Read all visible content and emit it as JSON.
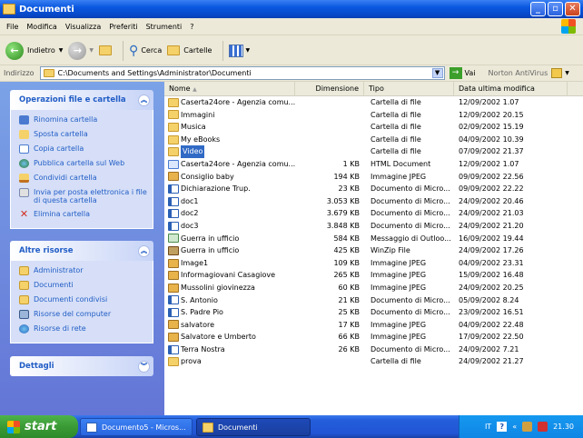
{
  "window": {
    "title": "Documenti"
  },
  "menu": [
    "File",
    "Modifica",
    "Visualizza",
    "Preferiti",
    "Strumenti",
    "?"
  ],
  "toolbar": {
    "back": "Indietro",
    "search": "Cerca",
    "folders": "Cartelle"
  },
  "address": {
    "label": "Indirizzo",
    "path": "C:\\Documents and Settings\\Administrator\\Documenti",
    "go": "Vai",
    "antivirus": "Norton AntiVirus"
  },
  "tasks": {
    "file_folder": {
      "title": "Operazioni file e cartella",
      "items": [
        "Rinomina cartella",
        "Sposta cartella",
        "Copia cartella",
        "Pubblica cartella sul Web",
        "Condividi cartella",
        "Invia per posta elettronica i file di questa cartella",
        "Elimina cartella"
      ]
    },
    "other": {
      "title": "Altre risorse",
      "items": [
        "Administrator",
        "Documenti",
        "Documenti condivisi",
        "Risorse del computer",
        "Risorse di rete"
      ]
    },
    "details": {
      "title": "Dettagli"
    }
  },
  "columns": {
    "name": "Nome",
    "size": "Dimensione",
    "type": "Tipo",
    "date": "Data ultima modifica"
  },
  "files": [
    {
      "name": "Caserta24ore - Agenzia comu...",
      "size": "",
      "type": "Cartella di file",
      "date": "12/09/2002 1.07",
      "icon": "folder"
    },
    {
      "name": "Immagini",
      "size": "",
      "type": "Cartella di file",
      "date": "12/09/2002 20.15",
      "icon": "folder"
    },
    {
      "name": "Musica",
      "size": "",
      "type": "Cartella di file",
      "date": "02/09/2002 15.19",
      "icon": "folder"
    },
    {
      "name": "My eBooks",
      "size": "",
      "type": "Cartella di file",
      "date": "04/09/2002 10.39",
      "icon": "folder"
    },
    {
      "name": "Video",
      "size": "",
      "type": "Cartella di file",
      "date": "07/09/2002 21.37",
      "icon": "folder",
      "selected": true
    },
    {
      "name": "Caserta24ore - Agenzia comu...",
      "size": "1 KB",
      "type": "HTML Document",
      "date": "12/09/2002 1.07",
      "icon": "html"
    },
    {
      "name": "Consiglio baby",
      "size": "194 KB",
      "type": "Immagine JPEG",
      "date": "09/09/2002 22.56",
      "icon": "jpeg"
    },
    {
      "name": "Dichiarazione Trup.",
      "size": "23 KB",
      "type": "Documento di Micro...",
      "date": "09/09/2002 22.22",
      "icon": "doc"
    },
    {
      "name": "doc1",
      "size": "3.053 KB",
      "type": "Documento di Micro...",
      "date": "24/09/2002 20.46",
      "icon": "doc"
    },
    {
      "name": "doc2",
      "size": "3.679 KB",
      "type": "Documento di Micro...",
      "date": "24/09/2002 21.03",
      "icon": "doc"
    },
    {
      "name": "doc3",
      "size": "3.848 KB",
      "type": "Documento di Micro...",
      "date": "24/09/2002 21.20",
      "icon": "doc"
    },
    {
      "name": "Guerra in ufficio",
      "size": "584 KB",
      "type": "Messaggio di Outloo...",
      "date": "16/09/2002 19.44",
      "icon": "msg"
    },
    {
      "name": "Guerra in ufficio",
      "size": "425 KB",
      "type": "WinZip File",
      "date": "24/09/2002 17.26",
      "icon": "zip"
    },
    {
      "name": "Image1",
      "size": "109 KB",
      "type": "Immagine JPEG",
      "date": "04/09/2002 23.31",
      "icon": "jpeg"
    },
    {
      "name": "Informagiovani Casagiove",
      "size": "265 KB",
      "type": "Immagine JPEG",
      "date": "15/09/2002 16.48",
      "icon": "jpeg"
    },
    {
      "name": "Mussolini giovinezza",
      "size": "60 KB",
      "type": "Immagine JPEG",
      "date": "24/09/2002 20.25",
      "icon": "jpeg"
    },
    {
      "name": "S. Antonio",
      "size": "21 KB",
      "type": "Documento di Micro...",
      "date": "05/09/2002 8.24",
      "icon": "doc"
    },
    {
      "name": "S. Padre Pio",
      "size": "25 KB",
      "type": "Documento di Micro...",
      "date": "23/09/2002 16.51",
      "icon": "doc"
    },
    {
      "name": "salvatore",
      "size": "17 KB",
      "type": "Immagine JPEG",
      "date": "04/09/2002 22.48",
      "icon": "jpeg"
    },
    {
      "name": "Salvatore e Umberto",
      "size": "66 KB",
      "type": "Immagine JPEG",
      "date": "17/09/2002 22.50",
      "icon": "jpeg"
    },
    {
      "name": "Terra Nostra",
      "size": "26 KB",
      "type": "Documento di Micro...",
      "date": "24/09/2002 7.21",
      "icon": "doc"
    },
    {
      "name": "prova",
      "size": "",
      "type": "Cartella di file",
      "date": "24/09/2002 21.27",
      "icon": "folder"
    }
  ],
  "taskbar": {
    "start": "start",
    "task1": "Documento5 - Micros...",
    "task2": "Documenti",
    "lang": "IT",
    "clock": "21.30"
  }
}
